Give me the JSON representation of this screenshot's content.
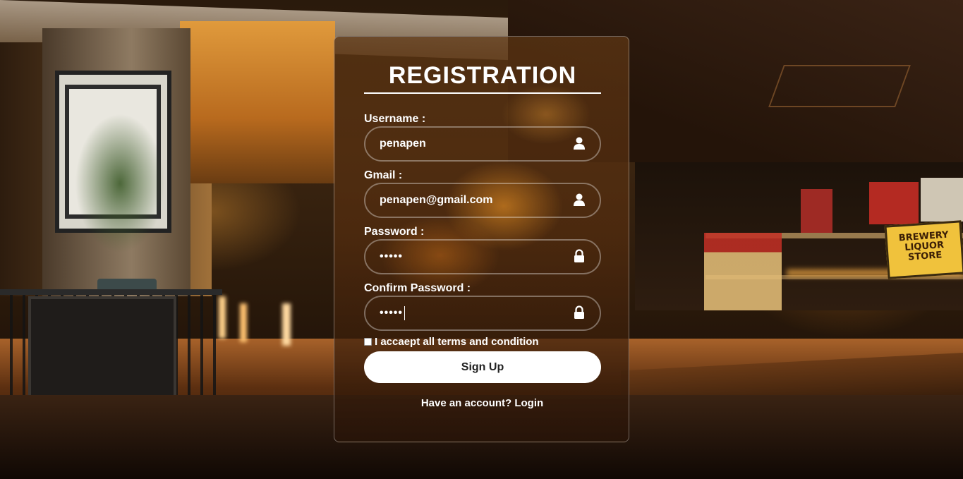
{
  "form": {
    "title": "REGISTRATION",
    "fields": [
      {
        "label": "Username :",
        "value": "penapen",
        "icon": "user-icon"
      },
      {
        "label": "Gmail :",
        "value": "penapen@gmail.com",
        "icon": "user-icon"
      },
      {
        "label": "Password :",
        "value": "•••••",
        "icon": "lock-icon"
      },
      {
        "label": "Confirm Password :",
        "value": "•••••",
        "icon": "lock-icon"
      }
    ],
    "terms_label": "I accaept all terms and condition",
    "terms_checked": false,
    "submit_label": "Sign Up",
    "login_prompt": "Have an account?",
    "login_link": "Login"
  },
  "background": {
    "sign_text": "BREWERY LIQUOR STORE"
  }
}
